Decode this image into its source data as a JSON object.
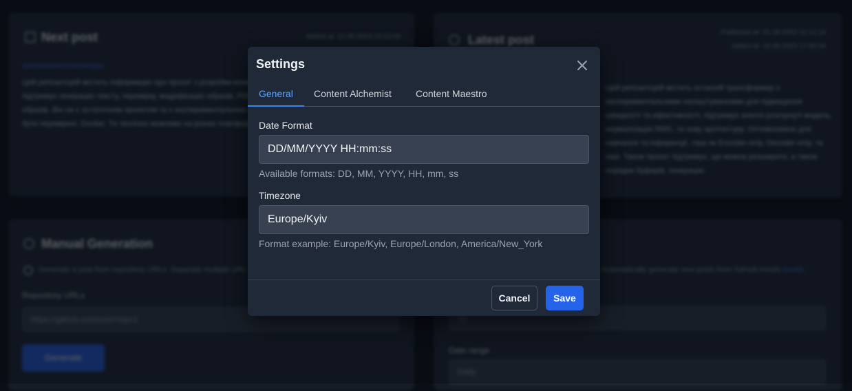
{
  "background": {
    "next_post": {
      "title": "Next post",
      "meta": "Added at: 12.09.2023 14:13:08",
      "link": "someowner/somerepo",
      "body": "Цей репозиторій містить інформацію про проєкт з розробки комерційного рішення для контенту. Проєкт підтримує генерацію тексту, перевірку, модифікацію образів, PDF документів та аналізу підписаних образів. Він не є остаточним проектом та є експериментальною з сучасні можливостями, які не можуть бути перевірені. Docker. Та технічно можливо на різних платформах, включно Windows."
    },
    "latest_post": {
      "title": "Latest post",
      "meta_line1": "Published at: 01.09.2023 12:12:14",
      "meta_line2": "Added at: 10.09.2023 17:00:04",
      "body": "Цей репозиторій містить останній трансформер з експериментальними налаштуваннями для підвищення швидкості та ефективності, підтримує агенти розгорнуті модель, нормалізацію RMS, та нову архітектуру. Оптимізовано для навчання та інференції, така як Encoder-only, Decoder-only, та інші. Також проєкт підтримує, що можна розширити, а також порядок буферів, генерацію."
    },
    "manual_generation": {
      "title": "Manual Generation",
      "hint": "Generate a post from repository URLs. Separate multiple URLs with commas.",
      "label": "Repository URLs",
      "placeholder": "https://github.com/user/repo1",
      "button": "Generate"
    },
    "auto_generation": {
      "hint": "Automatically generate new posts from GitHub trends",
      "hint_link": "trends",
      "input_value": "10",
      "label": "Date range",
      "select_value": "Daily"
    }
  },
  "modal": {
    "title": "Settings",
    "tabs": [
      {
        "label": "General",
        "active": true
      },
      {
        "label": "Content Alchemist",
        "active": false
      },
      {
        "label": "Content Maestro",
        "active": false
      }
    ],
    "date_format": {
      "label": "Date Format",
      "value": "DD/MM/YYYY HH:mm:ss",
      "help": "Available formats: DD, MM, YYYY, HH, mm, ss"
    },
    "timezone": {
      "label": "Timezone",
      "value": "Europe/Kyiv",
      "help": "Format example: Europe/Kyiv, Europe/London, America/New_York"
    },
    "cancel_label": "Cancel",
    "save_label": "Save"
  },
  "colors": {
    "accent": "#3b82f6",
    "primary_button": "#2563eb",
    "modal_bg": "#1f2937",
    "input_bg": "#374151"
  },
  "icons": {
    "close": "close-icon"
  }
}
